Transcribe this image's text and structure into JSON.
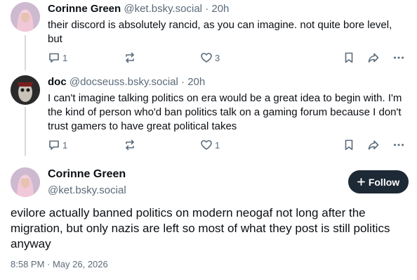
{
  "posts": [
    {
      "author": "Corinne Green",
      "handle": "@ket.bsky.social",
      "dot": "·",
      "time": "20h",
      "text": "their discord is absolutely rancid, as you can imagine. not quite bore level, but",
      "reply_count": "1",
      "like_count": "3"
    },
    {
      "author": "doc",
      "handle": "@docseuss.bsky.social",
      "dot": "·",
      "time": "20h",
      "text": "I can't imagine talking politics on era would be a great idea to begin with. I'm the kind of person who'd ban politics talk on a gaming forum because I don't trust gamers to have great political takes",
      "reply_count": "1",
      "like_count": "1"
    }
  ],
  "main": {
    "author": "Corinne Green",
    "handle": "@ket.bsky.social",
    "follow_label": "Follow",
    "text": "evilore actually banned politics on modern neogaf not long after the migration, but only nazis are left so most of what they post is still politics anyway",
    "timestamp": "8:58 PM · May 26, 2026"
  },
  "icons": {
    "reply": "reply-icon",
    "repost": "repost-icon",
    "like": "like-icon",
    "bookmark": "bookmark-icon",
    "share": "share-icon",
    "more": "more-icon",
    "plus": "plus-icon"
  },
  "colors": {
    "follow_bg": "#1e2936",
    "muted": "#5b6b7a",
    "thread_line": "#d4dbe2"
  }
}
